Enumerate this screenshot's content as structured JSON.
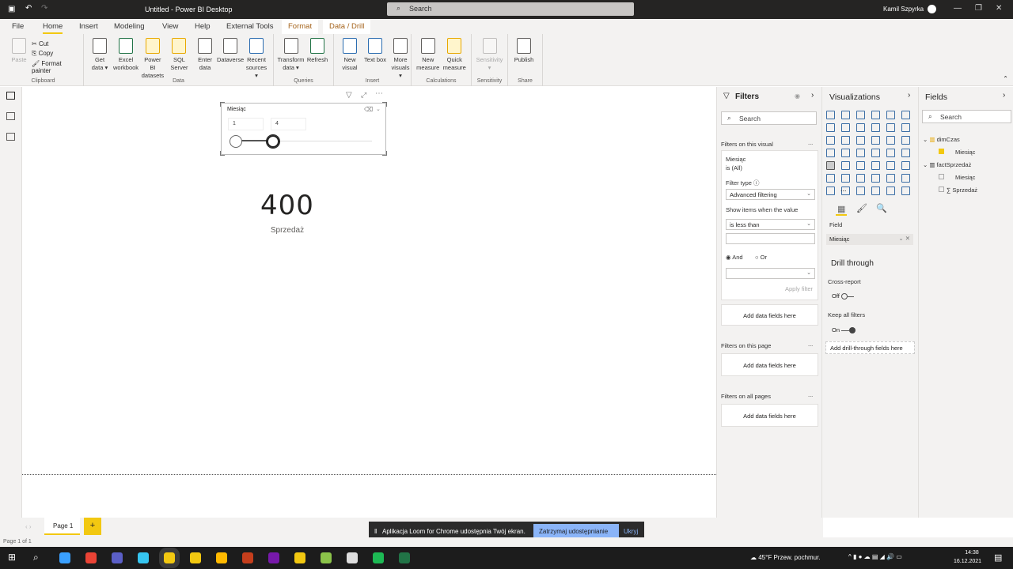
{
  "titlebar": {
    "title": "Untitled - Power BI Desktop",
    "search": "Search",
    "user": "Kamil Szpyrka"
  },
  "tabs": [
    "File",
    "Home",
    "Insert",
    "Modeling",
    "View",
    "Help",
    "External Tools"
  ],
  "context_tabs": [
    "Format",
    "Data / Drill"
  ],
  "ribbon": {
    "clipboard": {
      "paste": "Paste",
      "cut": "Cut",
      "copy": "Copy",
      "format_painter": "Format painter",
      "label": "Clipboard"
    },
    "data": {
      "buttons": [
        "Get data ▾",
        "Excel workbook",
        "Power BI datasets",
        "SQL Server",
        "Enter data",
        "Dataverse",
        "Recent sources ▾"
      ],
      "label": "Data"
    },
    "queries": {
      "buttons": [
        "Transform data ▾",
        "Refresh"
      ],
      "label": "Queries"
    },
    "insert": {
      "buttons": [
        "New visual",
        "Text box",
        "More visuals ▾"
      ],
      "label": "Insert"
    },
    "calculations": {
      "buttons": [
        "New measure",
        "Quick measure"
      ],
      "label": "Calculations"
    },
    "sensitivity": {
      "buttons": [
        "Sensitivity ▾"
      ],
      "label": "Sensitivity"
    },
    "share": {
      "buttons": [
        "Publish"
      ],
      "label": "Share"
    }
  },
  "slicer": {
    "title": "Miesiąc",
    "min": "1",
    "max": "4",
    "range_min": 1,
    "range_max": 12,
    "selected": [
      1,
      4
    ]
  },
  "card": {
    "value": "400",
    "label": "Sprzedaż"
  },
  "filters": {
    "title": "Filters",
    "search": "Search",
    "on_visual": "Filters on this visual",
    "field": "Miesiąc",
    "field_state": "is (All)",
    "filter_type_label": "Filter type",
    "filter_type": "Advanced filtering",
    "show_items": "Show items when the value",
    "condition": "is less than",
    "and": "And",
    "or": "Or",
    "apply": "Apply filter",
    "add_fields": "Add data fields here",
    "on_page": "Filters on this page",
    "on_all": "Filters on all pages",
    "more": "..."
  },
  "visualizations": {
    "title": "Visualizations",
    "field_label": "Field",
    "field_value": "Miesiąc",
    "drill_title": "Drill through",
    "cross_report": "Cross-report",
    "cross_state": "Off",
    "keep_filters": "Keep all filters",
    "keep_state": "On",
    "add_drill": "Add drill-through fields here",
    "more": "..."
  },
  "fields": {
    "title": "Fields",
    "search": "Search",
    "tables": [
      {
        "name": "dimCzas",
        "items": [
          {
            "name": "Miesiąc",
            "checked": true
          }
        ]
      },
      {
        "name": "factSprzedaż",
        "items": [
          {
            "name": "Miesiąc",
            "checked": false
          },
          {
            "name": "∑ Sprzedaż",
            "checked": false
          }
        ]
      }
    ]
  },
  "pages": {
    "current": "Page 1",
    "add": "+"
  },
  "status": "Page 1 of 1",
  "loom": {
    "message": "Aplikacja Loom for Chrome udostępnia Twój ekran.",
    "stop": "Zatrzymaj udostępnianie",
    "hide": "Ukryj"
  },
  "taskbar": {
    "weather": "45°F  Przew. pochmur.",
    "time": "14:38",
    "date": "16.12.2021"
  },
  "colors": {
    "accent": "#f2c811",
    "titlebar": "#252423",
    "loom_button": "#8ab4f8"
  }
}
